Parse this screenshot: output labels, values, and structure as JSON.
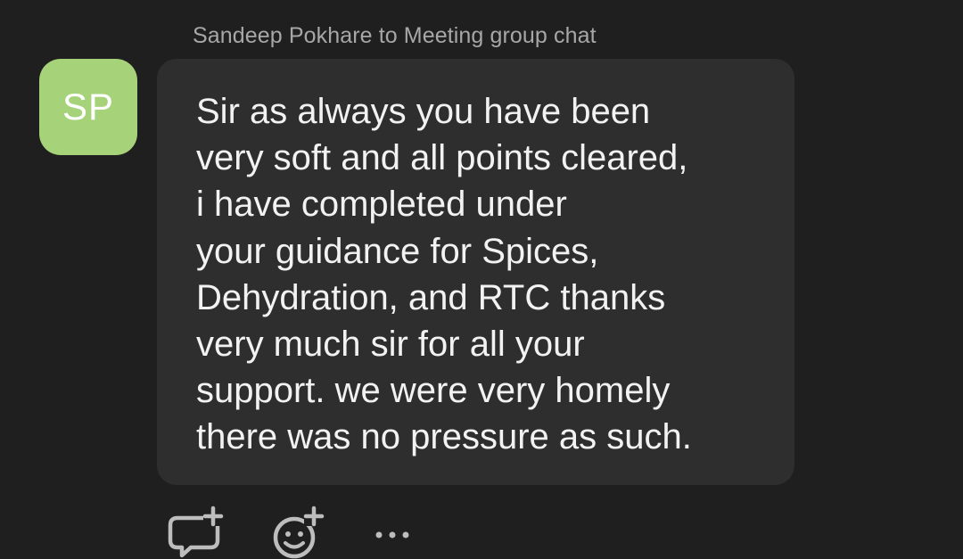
{
  "header": {
    "sender_line": "Sandeep Pokhare to Meeting group chat"
  },
  "avatar": {
    "initials": "SP",
    "color": "#a6d27a"
  },
  "message": {
    "lines": [
      "Sir as always you have been",
      "very soft and all points cleared,",
      "i have completed under",
      "your guidance for Spices,",
      "Dehydration, and RTC thanks",
      "very much sir for all your",
      "support. we were very homely",
      "there was no pressure as such."
    ]
  },
  "actions": {
    "reply_icon": "comment-add-icon",
    "react_icon": "emoji-add-icon",
    "more_icon": "more-horizontal-icon"
  },
  "colors": {
    "background": "#1f1f1f",
    "bubble": "#2e2e2e",
    "text": "#f2f2f2",
    "secondary_text": "#a7a7a7",
    "icon": "#bdbdbd"
  }
}
